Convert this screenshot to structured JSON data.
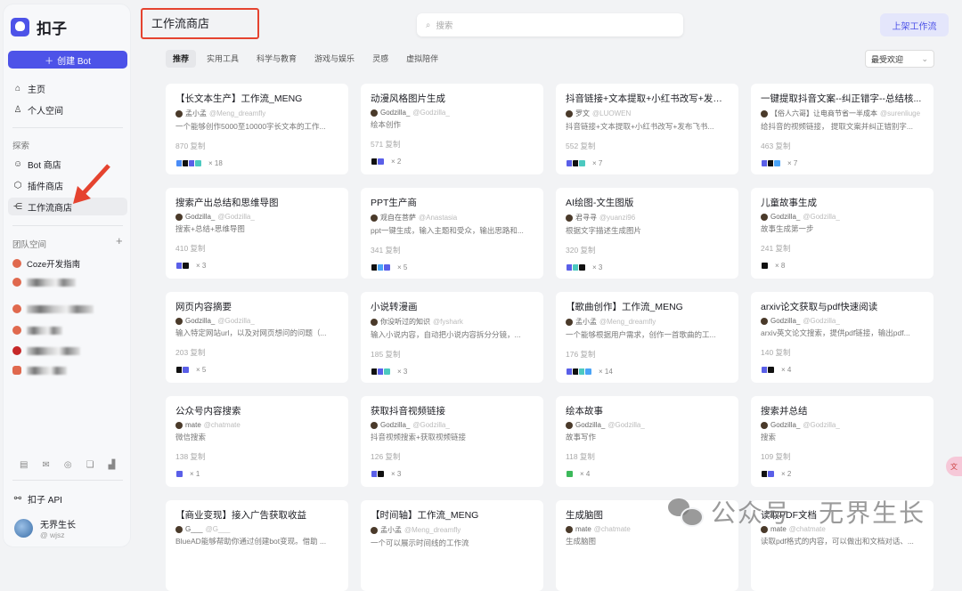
{
  "app": {
    "logo_text": "扣子",
    "create_label": "创建 Bot"
  },
  "sidebar": {
    "primary": [
      {
        "label": "主页",
        "icon": "home-icon"
      },
      {
        "label": "个人空间",
        "icon": "user-icon"
      }
    ],
    "explore_heading": "探索",
    "explore": [
      {
        "label": "Bot 商店",
        "icon": "bot-icon"
      },
      {
        "label": "插件商店",
        "icon": "cube-icon"
      },
      {
        "label": "工作流商店",
        "icon": "workflow-icon",
        "active": true
      }
    ],
    "team_heading": "团队空间",
    "team_first": "Coze开发指南",
    "api_label": "扣子 API",
    "user": {
      "name": "无界生长",
      "handle": "@ wjsz"
    }
  },
  "header": {
    "title": "工作流商店",
    "search_placeholder": "搜索",
    "publish_label": "上架工作流"
  },
  "tabs": [
    "推荐",
    "实用工具",
    "科学与教育",
    "游戏与娱乐",
    "灵感",
    "虚拟陪伴"
  ],
  "sort": {
    "selected": "最受欢迎"
  },
  "colors": {
    "accent": "#4d53e8",
    "annotation": "#e5432f"
  },
  "cards": [
    {
      "title": "【长文本生产】工作流_MENG",
      "author": "孟小孟",
      "handle": "@Meng_dreamfly",
      "desc": "一个能够创作5000至10000字长文本的工作...",
      "copies": "870 复制",
      "tools": [
        "#4a8cf7",
        "#111",
        "#5a5fe8",
        "#4cc9c0"
      ],
      "count": "× 18"
    },
    {
      "title": "动漫风格图片生成",
      "author": "Godzilla_",
      "handle": "@Godzilla_",
      "desc": "绘本创作",
      "copies": "571 复制",
      "tools": [
        "#111",
        "#5a5fe8"
      ],
      "count": "× 2"
    },
    {
      "title": "抖音链接+文本提取+小红书改写+发布...",
      "author": "罗文",
      "handle": "@LUOWEN",
      "desc": "抖音链接+文本提取+小红书改写+发布飞书...",
      "copies": "552 复制",
      "tools": [
        "#5a5fe8",
        "#111",
        "#4cc9c0"
      ],
      "count": "× 7"
    },
    {
      "title": "一键提取抖音文案--纠正错字--总结核...",
      "author": "【俗人六哥】让电商节省一半成本",
      "handle": "@surenliuge",
      "desc": "给抖音的视频链接， 提取文案并纠正错别字...",
      "copies": "463 复制",
      "tools": [
        "#5a5fe8",
        "#111",
        "#4aa3f7"
      ],
      "count": "× 7"
    },
    {
      "title": "搜索产出总结和思维导图",
      "author": "Godzilla_",
      "handle": "@Godzilla_",
      "desc": "搜索+总结+思维导图",
      "copies": "410 复制",
      "tools": [
        "#5a5fe8",
        "#111"
      ],
      "count": "× 3"
    },
    {
      "title": "PPT生产商",
      "author": "观自在菩萨",
      "handle": "@Anastasia",
      "desc": "ppt一键生成，输入主题和受众，输出思路和...",
      "copies": "341 复制",
      "tools": [
        "#111",
        "#4aa3f7",
        "#5a5fe8"
      ],
      "count": "× 5"
    },
    {
      "title": "AI绘图-文生图版",
      "author": "君寻寻",
      "handle": "@yuanzi96",
      "desc": "根据文字描述生成图片",
      "copies": "320 复制",
      "tools": [
        "#5a5fe8",
        "#4cc9c0",
        "#111"
      ],
      "count": "× 3"
    },
    {
      "title": "儿童故事生成",
      "author": "Godzilla_",
      "handle": "@Godzilla_",
      "desc": "故事生成第一步",
      "copies": "241 复制",
      "tools": [
        "#111"
      ],
      "count": "× 8"
    },
    {
      "title": "网页内容摘要",
      "author": "Godzilla_",
      "handle": "@Godzilla_",
      "desc": "输入特定网站url，以及对网页想问的问题（...",
      "copies": "203 复制",
      "tools": [
        "#111",
        "#5a5fe8"
      ],
      "count": "× 5"
    },
    {
      "title": "小说转漫画",
      "author": "你没听过的知识",
      "handle": "@fyshark",
      "desc": "输入小说内容，自动把小说内容拆分分镜，...",
      "copies": "185 复制",
      "tools": [
        "#111",
        "#5a5fe8",
        "#4cc9c0"
      ],
      "count": "× 3"
    },
    {
      "title": "【歌曲创作】工作流_MENG",
      "author": "孟小孟",
      "handle": "@Meng_dreamfly",
      "desc": "一个能够根据用户需求，创作一首歌曲的工...",
      "copies": "176 复制",
      "tools": [
        "#5a5fe8",
        "#111",
        "#4cc9c0",
        "#4aa3f7"
      ],
      "count": "× 14"
    },
    {
      "title": "arxiv论文获取与pdf快速阅读",
      "author": "Godzilla_",
      "handle": "@Godzilla_",
      "desc": "arxiv英文论文搜索，提供pdf链接，输出pdf...",
      "copies": "140 复制",
      "tools": [
        "#5a5fe8",
        "#111"
      ],
      "count": "× 4"
    },
    {
      "title": "公众号内容搜索",
      "author": "mate",
      "handle": "@chatmate",
      "desc": "微信搜索",
      "copies": "138 复制",
      "tools": [
        "#5a5fe8"
      ],
      "count": "× 1"
    },
    {
      "title": "获取抖音视频链接",
      "author": "Godzilla_",
      "handle": "@Godzilla_",
      "desc": "抖音视频搜索+获取视频链接",
      "copies": "126 复制",
      "tools": [
        "#5a5fe8",
        "#111"
      ],
      "count": "× 3"
    },
    {
      "title": "绘本故事",
      "author": "Godzilla_",
      "handle": "@Godzilla_",
      "desc": "故事写作",
      "copies": "118 复制",
      "tools": [
        "#3cb95a"
      ],
      "count": "× 4"
    },
    {
      "title": "搜索并总结",
      "author": "Godzilla_",
      "handle": "@Godzilla_",
      "desc": "搜索",
      "copies": "109 复制",
      "tools": [
        "#111",
        "#5a5fe8"
      ],
      "count": "× 2"
    },
    {
      "title": "【商业变现】接入广告获取收益",
      "author": "G___",
      "handle": "@G___",
      "desc": "BlueAD能够帮助你通过创建bot变现。借助 ...",
      "copies": "",
      "tools": [],
      "count": ""
    },
    {
      "title": "【时间轴】工作流_MENG",
      "author": "孟小孟",
      "handle": "@Meng_dreamfly",
      "desc": "一个可以展示时间线的工作流",
      "copies": "",
      "tools": [],
      "count": ""
    },
    {
      "title": "生成脑图",
      "author": "mate",
      "handle": "@chatmate",
      "desc": "生成脑图",
      "copies": "",
      "tools": [],
      "count": ""
    },
    {
      "title": "读取PDF文档",
      "author": "mate",
      "handle": "@chatmate",
      "desc": "读取pdf格式的内容，可以做出和文档对话、...",
      "copies": "",
      "tools": [],
      "count": ""
    }
  ],
  "watermark": {
    "left": "公众号 ·",
    "right": "无界生长"
  }
}
